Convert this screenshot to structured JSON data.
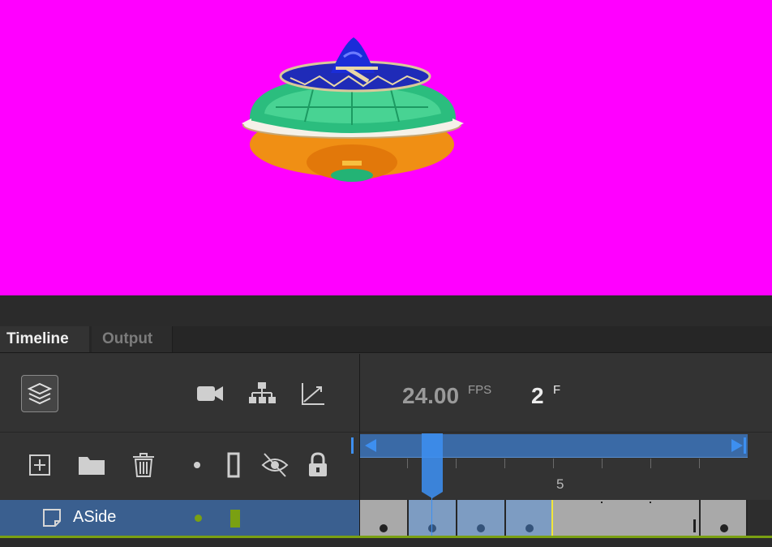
{
  "tabs": [
    {
      "label": "Timeline",
      "active": true
    },
    {
      "label": "Output",
      "active": false
    }
  ],
  "toolbar": {
    "icons": [
      "layers-view-icon",
      "camera-icon",
      "parenting-icon",
      "graph-icon"
    ]
  },
  "info": {
    "fps_value": "24.00",
    "fps_unit": "FPS",
    "frame_value": "2",
    "frame_unit": "F"
  },
  "layer_tools": {
    "icons": [
      "new-layer-icon",
      "new-folder-icon",
      "delete-icon",
      "highlight-dot-icon",
      "outline-icon",
      "hide-eye-icon",
      "lock-icon"
    ]
  },
  "ruler": {
    "labels": [
      "5"
    ]
  },
  "layer": {
    "name": "ASide"
  },
  "colors": {
    "stage": "#ff00ff",
    "accent": "#3d8ff0",
    "layer_selected": "#3a5f8f",
    "layer_color": "#7aa012"
  }
}
